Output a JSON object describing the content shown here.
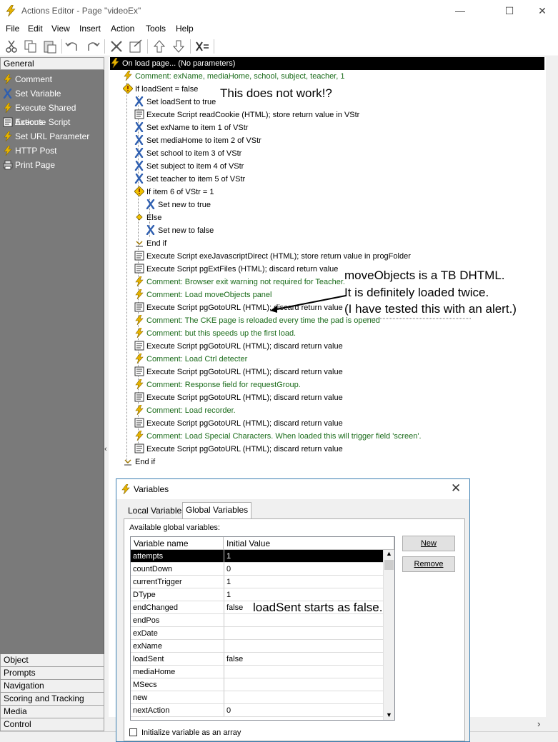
{
  "window": {
    "title": "Actions Editor - Page \"videoEx\"",
    "minimize": "—",
    "maximize": "☐",
    "close": "✕"
  },
  "menu": [
    "File",
    "Edit",
    "View",
    "Insert",
    "Action",
    "Tools",
    "Help"
  ],
  "toolbar_icons": [
    "cut-icon",
    "copy-icon",
    "paste-icon",
    "undo-icon",
    "redo-icon",
    "delete-icon",
    "properties-icon",
    "move-up-icon",
    "move-down-icon",
    "variables-icon"
  ],
  "left_pane": {
    "header": "General",
    "items": [
      {
        "label": "Comment",
        "icon": "lightning-icon"
      },
      {
        "label": "Set Variable",
        "icon": "x-variable-icon"
      },
      {
        "label": "Execute Shared Actions",
        "icon": "lightning-icon"
      },
      {
        "label": "Execute Script",
        "icon": "script-icon"
      },
      {
        "label": "Set URL Parameter",
        "icon": "lightning-icon"
      },
      {
        "label": "HTTP Post",
        "icon": "lightning-icon"
      },
      {
        "label": "Print Page",
        "icon": "printer-icon"
      }
    ],
    "categories": [
      "Object",
      "Prompts",
      "Navigation",
      "Scoring and Tracking",
      "Media",
      "Control"
    ]
  },
  "tree": {
    "rows": [
      {
        "level": 0,
        "icon": "lightning",
        "text": "On load page... (No parameters)",
        "selected": true
      },
      {
        "level": 1,
        "icon": "lightning",
        "prefix": "Comment: ",
        "text": "exName, mediaHome, school, subject, teacher, 1"
      },
      {
        "level": 1,
        "icon": "diamond",
        "text": "If loadSent = false"
      },
      {
        "level": 2,
        "icon": "x",
        "text": "Set loadSent to true"
      },
      {
        "level": 2,
        "icon": "script",
        "text": "Execute Script readCookie (HTML); store return value in VStr"
      },
      {
        "level": 2,
        "icon": "x",
        "text": "Set exName to item 1 of VStr"
      },
      {
        "level": 2,
        "icon": "x",
        "text": "Set mediaHome to item 2 of VStr"
      },
      {
        "level": 2,
        "icon": "x",
        "text": "Set school to item 3 of VStr"
      },
      {
        "level": 2,
        "icon": "x",
        "text": "Set subject to item 4 of VStr"
      },
      {
        "level": 2,
        "icon": "x",
        "text": "Set teacher to item 5 of VStr"
      },
      {
        "level": 2,
        "icon": "diamond",
        "text": "If item 6 of VStr = 1"
      },
      {
        "level": 3,
        "icon": "x",
        "text": "Set new to true"
      },
      {
        "level": 2,
        "icon": "small-diamond",
        "text": "Else"
      },
      {
        "level": 3,
        "icon": "x",
        "text": "Set new to false"
      },
      {
        "level": 2,
        "icon": "endif",
        "text": "End if"
      },
      {
        "level": 2,
        "icon": "script",
        "text": "Execute Script exeJavascriptDirect (HTML); store return value in progFolder"
      },
      {
        "level": 2,
        "icon": "script",
        "text": "Execute Script pgExtFiles (HTML); discard return value"
      },
      {
        "level": 2,
        "icon": "lightning",
        "prefix": "Comment: ",
        "text": "Browser exit warning not required for Teacher."
      },
      {
        "level": 2,
        "icon": "lightning",
        "prefix": "Comment: ",
        "text": "Load moveObjects panel"
      },
      {
        "level": 2,
        "icon": "script",
        "text": "Execute Script pgGotoURL (HTML); discard return value"
      },
      {
        "level": 2,
        "icon": "lightning",
        "prefix": "Comment: ",
        "text": "The CKE page is reloaded every time the pad is opened"
      },
      {
        "level": 2,
        "icon": "lightning",
        "prefix": "Comment: ",
        "text": "but this speeds up the first load."
      },
      {
        "level": 2,
        "icon": "script",
        "text": "Execute Script pgGotoURL (HTML); discard return value"
      },
      {
        "level": 2,
        "icon": "lightning",
        "prefix": "Comment: ",
        "text": "Load Ctrl detecter"
      },
      {
        "level": 2,
        "icon": "script",
        "text": "Execute Script pgGotoURL (HTML); discard return value"
      },
      {
        "level": 2,
        "icon": "lightning",
        "prefix": "Comment: ",
        "text": "Response field for requestGroup."
      },
      {
        "level": 2,
        "icon": "script",
        "text": "Execute Script pgGotoURL (HTML); discard return value"
      },
      {
        "level": 2,
        "icon": "lightning",
        "prefix": "Comment: ",
        "text": "Load recorder."
      },
      {
        "level": 2,
        "icon": "script",
        "text": "Execute Script pgGotoURL (HTML); discard return value"
      },
      {
        "level": 2,
        "icon": "lightning",
        "prefix": "Comment: ",
        "text": "Load Special Characters. When loaded this will trigger field 'screen'."
      },
      {
        "level": 2,
        "icon": "script",
        "text": "Execute Script pgGotoURL (HTML); discard return value"
      },
      {
        "level": 1,
        "icon": "endif",
        "text": "End if"
      }
    ]
  },
  "annotations": {
    "note1": "This does not work!?",
    "note2_line1": "moveObjects is a TB DHTML.",
    "note2_line2": "It is definitely loaded twice.",
    "note2_line3": "(I have tested this with an alert.)",
    "note3": "loadSent starts as false."
  },
  "dialog": {
    "title": "Variables",
    "close": "✕",
    "tabs": [
      "Local Variables",
      "Global Variables"
    ],
    "active_tab": 1,
    "available_label": "Available global variables:",
    "columns": [
      "Variable name",
      "Initial Value"
    ],
    "rows": [
      {
        "name": "attempts",
        "value": "1",
        "selected": true
      },
      {
        "name": "countDown",
        "value": "0"
      },
      {
        "name": "currentTrigger",
        "value": "1"
      },
      {
        "name": "DType",
        "value": "1"
      },
      {
        "name": "endChanged",
        "value": "false"
      },
      {
        "name": "endPos",
        "value": ""
      },
      {
        "name": "exDate",
        "value": ""
      },
      {
        "name": "exName",
        "value": ""
      },
      {
        "name": "loadSent",
        "value": "false"
      },
      {
        "name": "mediaHome",
        "value": ""
      },
      {
        "name": "MSecs",
        "value": ""
      },
      {
        "name": "new",
        "value": ""
      },
      {
        "name": "nextAction",
        "value": "0"
      }
    ],
    "new_button": "New",
    "remove_button": "Remove",
    "array_checkbox": "Initialize variable as an array"
  },
  "colors": {
    "selection": "#000000",
    "comment_text": "#1a6b1a",
    "left_pane_bg": "#7a7a7a",
    "lightning": "#e8b400",
    "x_blue": "#2f5fb0"
  }
}
